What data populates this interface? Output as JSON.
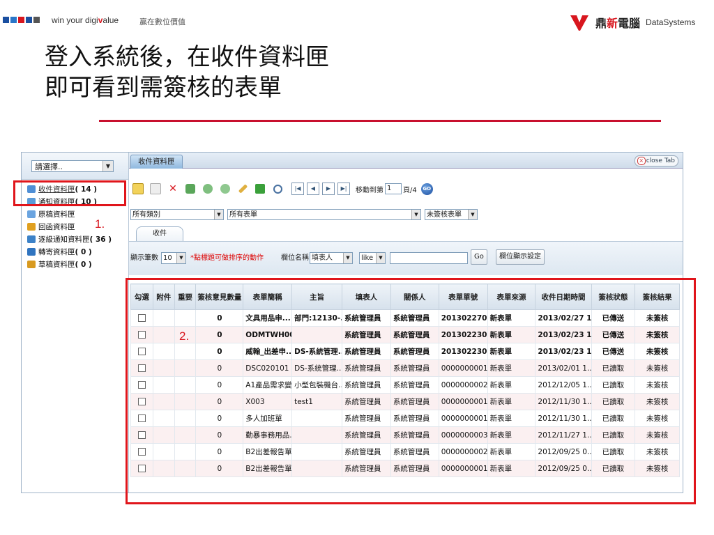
{
  "header": {
    "slogan_en": "win your digi",
    "slogan_v": "v",
    "slogan_en_tail": "alue",
    "slogan_zh": "贏在數位價值",
    "logo_zh_1": "鼎",
    "logo_zh_2": "新",
    "logo_zh_3": "電腦",
    "logo_en": "DataSystems",
    "square_colors": [
      "#1a4fa0",
      "#2a76c8",
      "#d8161e",
      "#1a4fa0",
      "#555555"
    ]
  },
  "slide": {
    "title_line1": "登入系統後，在收件資料匣",
    "title_line2": "即可看到需簽核的表單",
    "accent_color": "#c8102e"
  },
  "sidebar": {
    "select_value": "請選擇..",
    "items": [
      {
        "label": "收件資料匣",
        "count": "( 14 )",
        "icon": "inbox-icon",
        "color": "#4f8fd6"
      },
      {
        "label": "通知資料匣",
        "count": "( 10 )",
        "icon": "notice-icon",
        "color": "#5a9bd8"
      },
      {
        "label": "原稿資料匣",
        "count": "",
        "icon": "draft-icon",
        "color": "#6aa4e0"
      },
      {
        "label": "回函資料匣",
        "count": "",
        "icon": "reply-icon",
        "color": "#e0a020"
      },
      {
        "label": "逐級通知資料匣",
        "count": "( 36 )",
        "icon": "escalation-icon",
        "color": "#3c82c8"
      },
      {
        "label": "轉寄資料匣",
        "count": "( 0 )",
        "icon": "forward-icon",
        "color": "#2f74c0"
      },
      {
        "label": "草稿資料匣",
        "count": "( 0 )",
        "icon": "pencil-draft-icon",
        "color": "#d89a20"
      }
    ]
  },
  "tabs": {
    "active": "收件資料匣",
    "close_label": "close Tab"
  },
  "toolbar": {
    "goto_prefix": "移動到第",
    "page_value": "1",
    "goto_suffix": "頁/4",
    "go_label": "GO"
  },
  "filters": {
    "category": "所有類別",
    "form": "所有表單",
    "status": "未簽核表單"
  },
  "subtab": {
    "label": "收件"
  },
  "search": {
    "page_size_label": "顯示筆數",
    "page_size": "10",
    "hint": "*點標題可做排序的動作",
    "field_label": "欄位名稱",
    "field_value": "填表人",
    "op_value": "like",
    "query_value": "",
    "go_label": "Go",
    "settings_label": "欄位顯示設定"
  },
  "table": {
    "headers": [
      "勾選",
      "附件",
      "重要",
      "簽核意見數量",
      "表單簡稱",
      "主旨",
      "填表人",
      "關係人",
      "表單單號",
      "表單來源",
      "收件日期時間",
      "簽核狀態",
      "簽核結果"
    ],
    "rows": [
      {
        "bold": true,
        "count": "0",
        "form": "文具用品申...",
        "subject": "部門:12130-...",
        "filler": "系統管理員",
        "related": "系統管理員",
        "no": "201302270001",
        "source": "新表單",
        "date": "2013/02/27 1...",
        "status": "已傳送",
        "result": "未簽核"
      },
      {
        "bold": true,
        "count": "0",
        "form": "ODMTWH002",
        "subject": "",
        "filler": "系統管理員",
        "related": "系統管理員",
        "no": "201302230001",
        "source": "新表單",
        "date": "2013/02/23 1...",
        "status": "已傳送",
        "result": "未簽核"
      },
      {
        "bold": true,
        "count": "0",
        "form": "威翰_出差申...",
        "subject": "DS-系統管理...",
        "filler": "系統管理員",
        "related": "系統管理員",
        "no": "201302230001",
        "source": "新表單",
        "date": "2013/02/23 1...",
        "status": "已傳送",
        "result": "未簽核"
      },
      {
        "bold": false,
        "count": "0",
        "form": "DSC020101",
        "subject": "DS-系統管理...",
        "filler": "系統管理員",
        "related": "系統管理員",
        "no": "0000000001",
        "source": "新表單",
        "date": "2013/02/01 1...",
        "status": "已讀取",
        "result": "未簽核"
      },
      {
        "bold": false,
        "count": "0",
        "form": "A1產品需求變...",
        "subject": "小型包裝機台...",
        "filler": "系統管理員",
        "related": "系統管理員",
        "no": "0000000002",
        "source": "新表單",
        "date": "2012/12/05 1...",
        "status": "已讀取",
        "result": "未簽核"
      },
      {
        "bold": false,
        "count": "0",
        "form": "X003",
        "subject": "test1",
        "filler": "系統管理員",
        "related": "系統管理員",
        "no": "0000000001",
        "source": "新表單",
        "date": "2012/11/30 1...",
        "status": "已讀取",
        "result": "未簽核"
      },
      {
        "bold": false,
        "count": "0",
        "form": "多人加班單",
        "subject": "",
        "filler": "系統管理員",
        "related": "系統管理員",
        "no": "0000000001",
        "source": "新表單",
        "date": "2012/11/30 1...",
        "status": "已讀取",
        "result": "未簽核"
      },
      {
        "bold": false,
        "count": "0",
        "form": "勤暴事務用品...",
        "subject": "",
        "filler": "系統管理員",
        "related": "系統管理員",
        "no": "0000000003",
        "source": "新表單",
        "date": "2012/11/27 1...",
        "status": "已讀取",
        "result": "未簽核"
      },
      {
        "bold": false,
        "count": "0",
        "form": "B2出差報告單",
        "subject": "",
        "filler": "系統管理員",
        "related": "系統管理員",
        "no": "0000000002",
        "source": "新表單",
        "date": "2012/09/25 0...",
        "status": "已讀取",
        "result": "未簽核"
      },
      {
        "bold": false,
        "count": "0",
        "form": "B2出差報告單",
        "subject": "",
        "filler": "系統管理員",
        "related": "系統管理員",
        "no": "0000000001",
        "source": "新表單",
        "date": "2012/09/25 0...",
        "status": "已讀取",
        "result": "未簽核"
      }
    ]
  },
  "annotations": {
    "one": "1.",
    "two": "2.",
    "highlight_color": "#e0151b"
  }
}
